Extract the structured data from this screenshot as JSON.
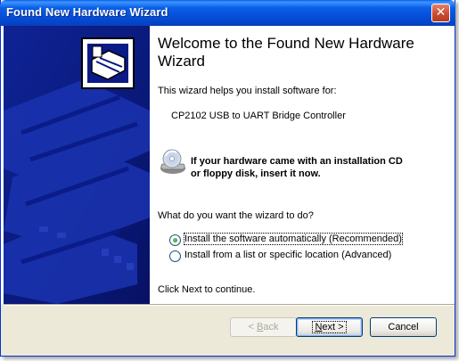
{
  "window": {
    "title": "Found New Hardware Wizard"
  },
  "heading": "Welcome to the Found New Hardware Wizard",
  "intro": "This wizard helps you install software for:",
  "device_name": "CP2102 USB to UART Bridge Controller",
  "cd_notice_line1": "If your hardware came with an installation CD",
  "cd_notice_line2": "or floppy disk, insert it now.",
  "question": "What do you want the wizard to do?",
  "options": [
    {
      "label": "Install the software automatically (Recommended)",
      "selected": true
    },
    {
      "label": "Install from a list or specific location (Advanced)",
      "selected": false
    }
  ],
  "continue_text": "Click Next to continue.",
  "buttons": {
    "back": {
      "prefix": "< ",
      "accel": "B",
      "rest": "ack"
    },
    "next": {
      "accel": "N",
      "rest": "ext >"
    },
    "cancel": "Cancel"
  }
}
